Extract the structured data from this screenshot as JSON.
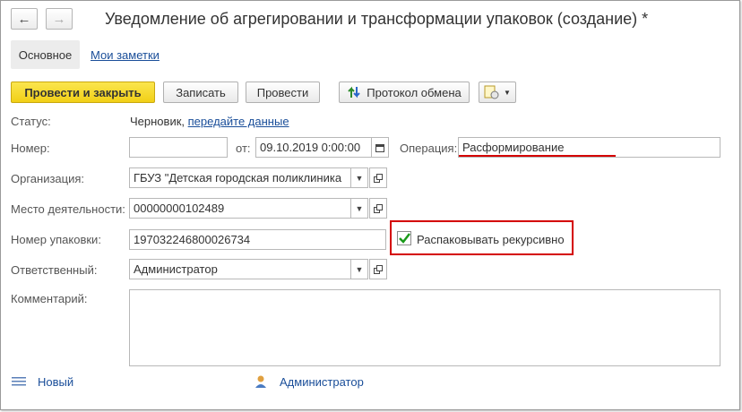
{
  "window": {
    "title": "Уведомление об агрегировании и трансформации упаковок (создание) *"
  },
  "nav": {
    "back_icon": "←",
    "forward_icon": "→"
  },
  "tabs": {
    "main": "Основное",
    "notes": "Мои заметки"
  },
  "toolbar": {
    "post_close": "Провести и закрыть",
    "save": "Записать",
    "post": "Провести",
    "exchange_log": "Протокол обмена"
  },
  "form": {
    "status_label": "Статус:",
    "status_value": "Черновик,",
    "status_link": "передайте данные",
    "number_label": "Номер:",
    "number_value": "",
    "date_label": "от:",
    "date_value": "09.10.2019  0:00:00",
    "operation_label": "Операция:",
    "operation_value": "Расформирование",
    "org_label": "Организация:",
    "org_value": "ГБУЗ \"Детская городская поликлиника ",
    "place_label": "Место деятельности:",
    "place_value": "00000000102489",
    "package_label": "Номер упаковки:",
    "package_value": "197032246800026734",
    "recursive_label": "Распаковывать рекурсивно",
    "recursive_checked": true,
    "responsible_label": "Ответственный:",
    "responsible_value": "Администратор",
    "comment_label": "Комментарий:",
    "comment_value": ""
  },
  "footer": {
    "new_label": "Новый",
    "user_label": "Администратор"
  },
  "colors": {
    "primary_button": "#f5d922",
    "link": "#1a4e99",
    "highlight": "#d40000",
    "check": "#1a9a1a"
  }
}
